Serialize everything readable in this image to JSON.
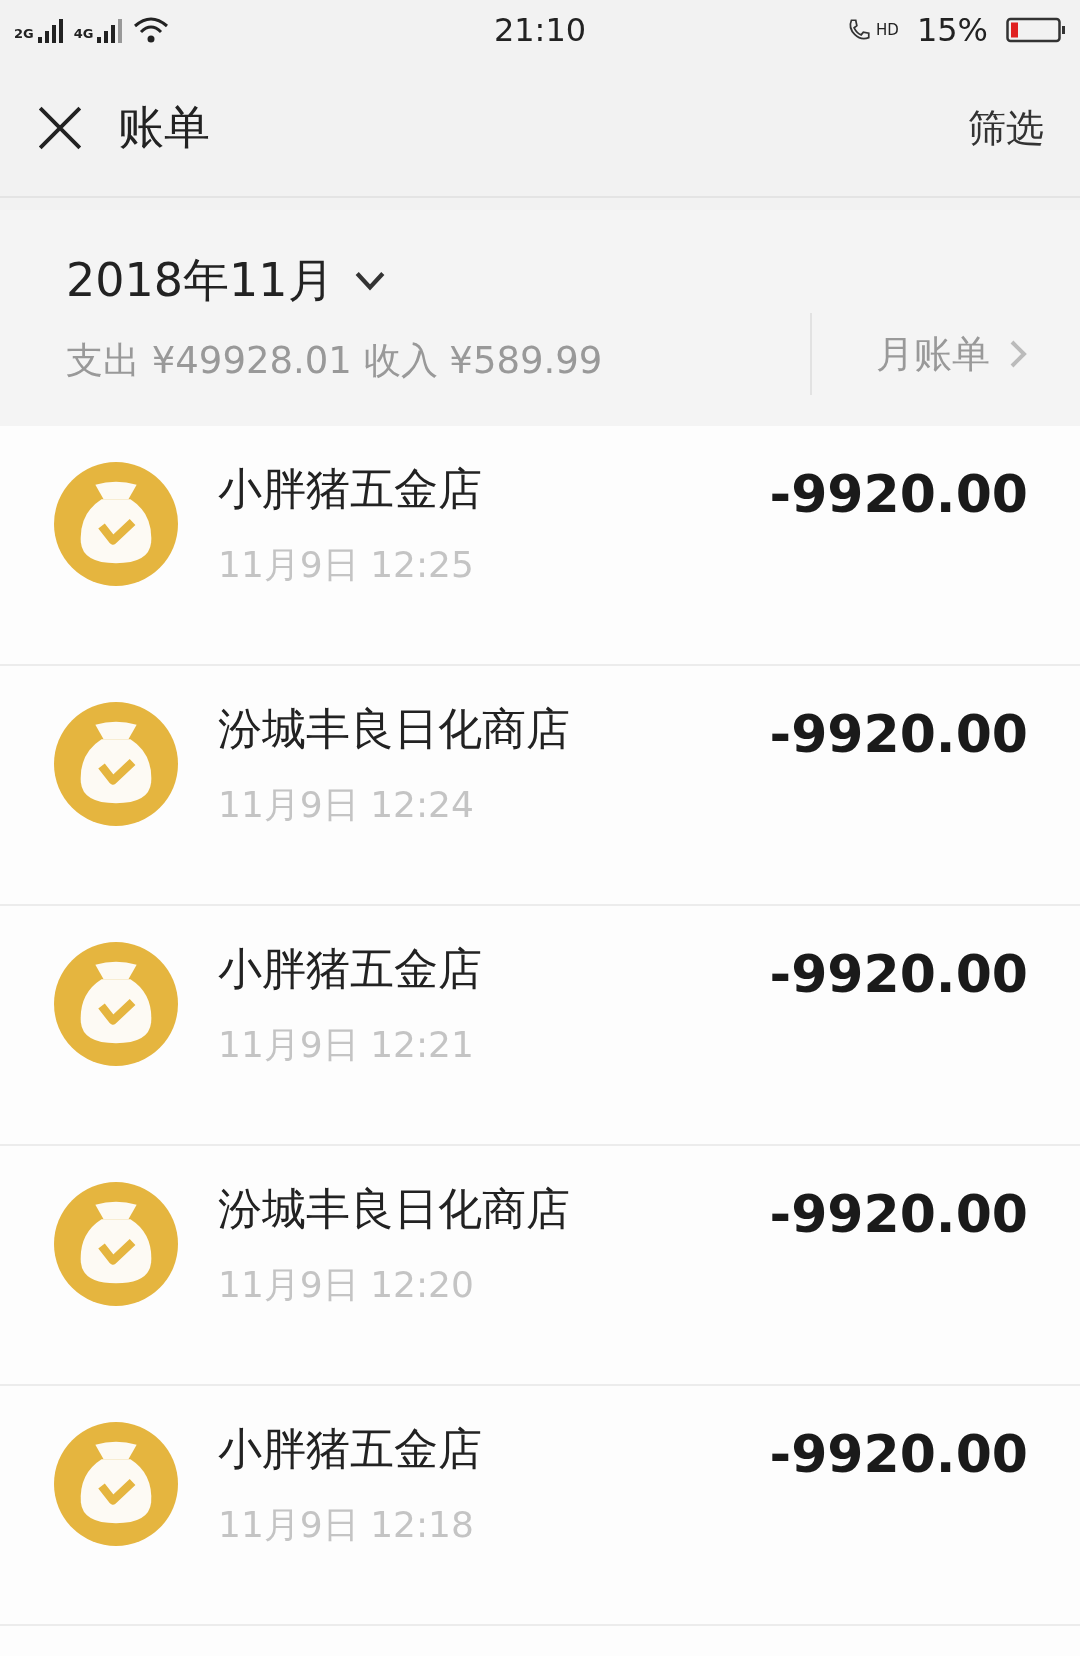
{
  "status_bar": {
    "signal_1": "2G",
    "signal_2": "4G",
    "time": "21:10",
    "hd": "HD",
    "battery": "15%"
  },
  "header": {
    "title": "账单",
    "filter": "筛选"
  },
  "month": {
    "label": "2018年11月",
    "summary": "支出 ¥49928.01 收入 ¥589.99",
    "monthly_bill": "月账单"
  },
  "transactions": [
    {
      "name": "小胖猪五金店",
      "time": "11月9日 12:25",
      "amount": "-9920.00"
    },
    {
      "name": "汾城丰良日化商店",
      "time": "11月9日 12:24",
      "amount": "-9920.00"
    },
    {
      "name": "小胖猪五金店",
      "time": "11月9日 12:21",
      "amount": "-9920.00"
    },
    {
      "name": "汾城丰良日化商店",
      "time": "11月9日 12:20",
      "amount": "-9920.00"
    },
    {
      "name": "小胖猪五金店",
      "time": "11月9日 12:18",
      "amount": "-9920.00"
    }
  ]
}
